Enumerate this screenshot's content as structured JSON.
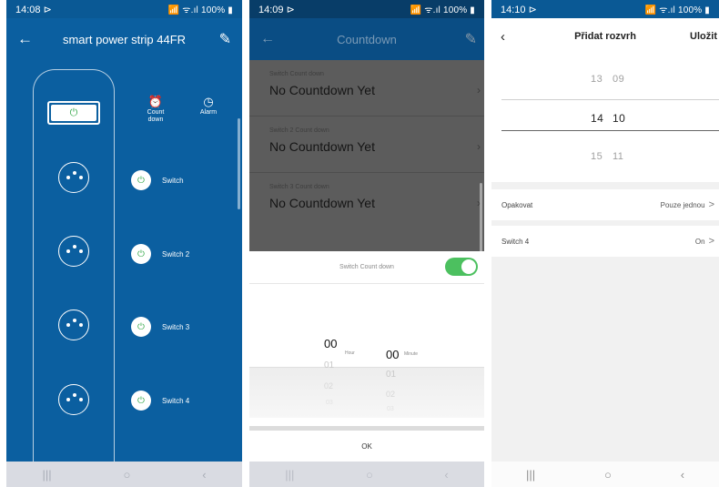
{
  "phone1": {
    "status": {
      "time": "14:08",
      "indicator": "⊳",
      "right": "📶 ᯤ.ıl 100% ▮"
    },
    "title": "smart power strip 44FR",
    "back_icon": "←",
    "edit_icon": "✎",
    "master_icon": "⏻",
    "tools": [
      {
        "icon": "⏰",
        "label": "Count down"
      },
      {
        "icon": "◷",
        "label": "Alarm"
      }
    ],
    "switches": [
      {
        "label": "Switch"
      },
      {
        "label": "Switch 2"
      },
      {
        "label": "Switch 3"
      },
      {
        "label": "Switch 4"
      }
    ],
    "power_icon": "⏻",
    "nav": [
      "|||",
      "○",
      "‹"
    ]
  },
  "phone2": {
    "status": {
      "time": "14:09",
      "indicator": "⊳",
      "right": "📶 ᯤ.ıl 100% ▮"
    },
    "title": "Countdown",
    "back_icon": "←",
    "edit_icon": "✎",
    "rows": [
      {
        "label": "Switch Count down",
        "value": "No Countdown Yet"
      },
      {
        "label": "Switch 2 Count down",
        "value": "No Countdown Yet"
      },
      {
        "label": "Switch 3 Count down",
        "value": "No Countdown Yet"
      }
    ],
    "chevron": "›",
    "sheet_title": "Switch Count down",
    "picker": {
      "hour_selected": "00",
      "hour_label": "Hour",
      "minute_selected": "00",
      "minute_label": "Minute",
      "hour_below": [
        "01",
        "02",
        "03"
      ],
      "minute_below": [
        "01",
        "02",
        "03"
      ]
    },
    "ok_label": "OK",
    "toggle_on": true,
    "accent": "#4cc05f",
    "nav": [
      "|||",
      "○",
      "‹"
    ]
  },
  "phone3": {
    "status": {
      "time": "14:10",
      "indicator": "⊳",
      "right": "📶 ᯤ.ıl 100% ▮"
    },
    "title": "Přidat rozvrh",
    "save_label": "Uložit",
    "back_icon": "‹",
    "time_rows": [
      {
        "hour": "13",
        "minute": "09"
      },
      {
        "hour": "14",
        "minute": "10"
      },
      {
        "hour": "15",
        "minute": "11"
      }
    ],
    "settings": [
      {
        "label": "Opakovat",
        "value": "Pouze jednou"
      },
      {
        "label": "Switch 4",
        "value": "On"
      }
    ],
    "chevron": ">",
    "nav": [
      "|||",
      "○",
      "‹"
    ]
  }
}
